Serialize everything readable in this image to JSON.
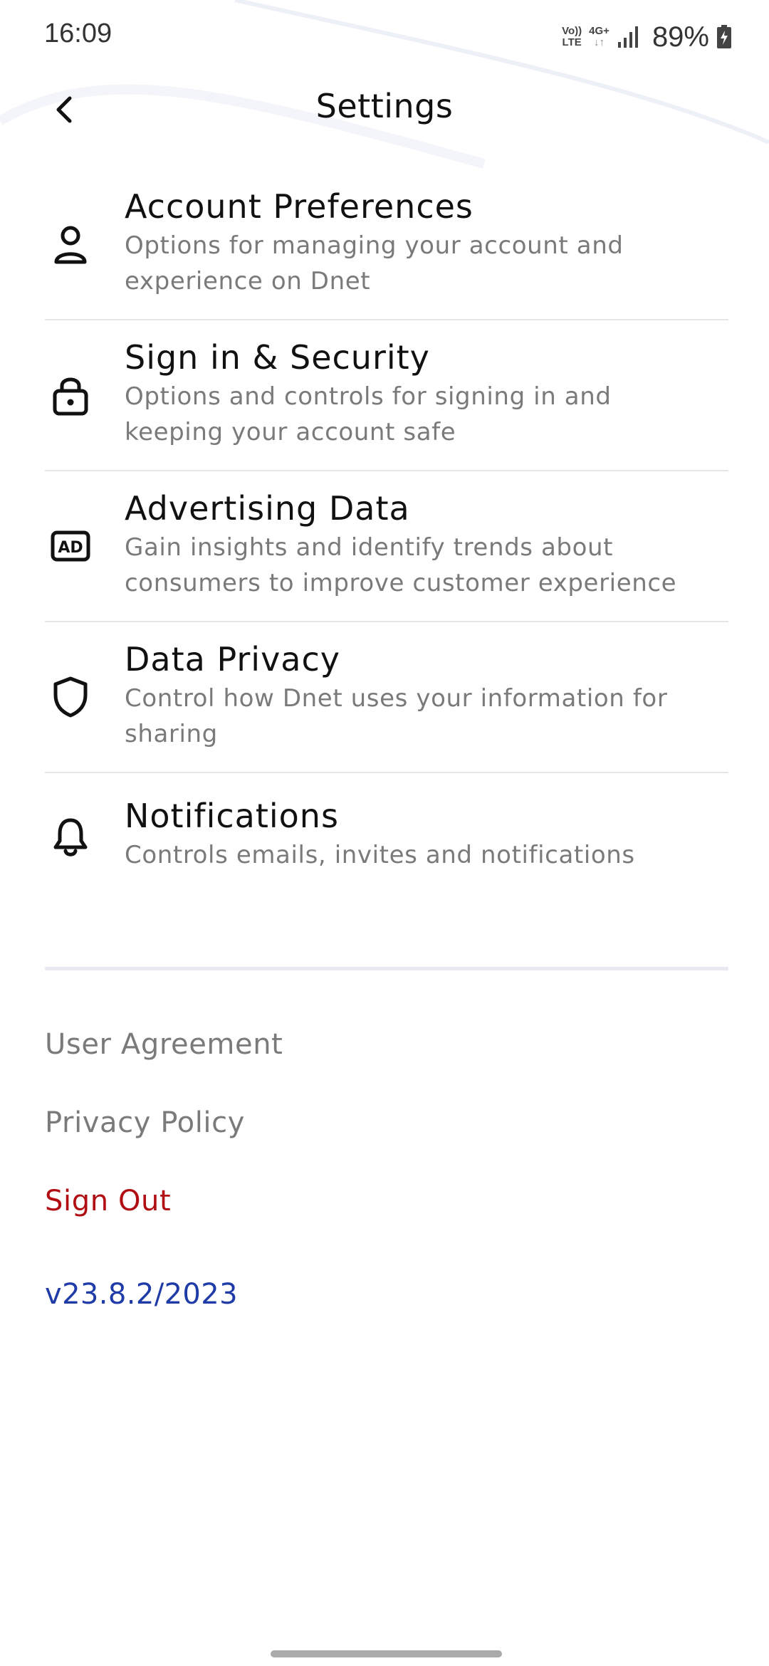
{
  "status_bar": {
    "time": "16:09",
    "volte_top": "Vo))",
    "volte_bottom": "LTE",
    "network_top": "4G+",
    "network_bottom": "↓↑",
    "battery_percent": "89%",
    "signal_icon": "signal-bars-icon",
    "battery_icon": "battery-charging-icon"
  },
  "header": {
    "title": "Settings",
    "back_icon": "chevron-left-icon"
  },
  "settings": [
    {
      "icon": "person-icon",
      "title": "Account Preferences",
      "description_line1": "Options for managing your account and",
      "description_line2": "experience on Dnet"
    },
    {
      "icon": "lock-icon",
      "title": "Sign in & Security",
      "description_line1": "Options and controls for signing in and",
      "description_line2": "keeping your account safe"
    },
    {
      "icon": "ad-icon",
      "icon_text": "AD",
      "title": "Advertising Data",
      "description_line1": "Gain insights and identify trends about",
      "description_line2": "consumers to improve customer experience"
    },
    {
      "icon": "shield-icon",
      "title": "Data Privacy",
      "description_line1": "Control how Dnet uses your information for",
      "description_line2": "sharing"
    },
    {
      "icon": "bell-icon",
      "title": "Notifications",
      "description_line1": "Controls emails, invites and notifications"
    }
  ],
  "footer": {
    "user_agreement": "User Agreement",
    "privacy_policy": "Privacy Policy",
    "sign_out": "Sign Out",
    "version": "v23.8.2/2023"
  },
  "colors": {
    "sign_out": "#b00e12",
    "version": "#1f3ba8",
    "secondary_text": "#7a7a7a",
    "divider": "#e6e6ea"
  }
}
